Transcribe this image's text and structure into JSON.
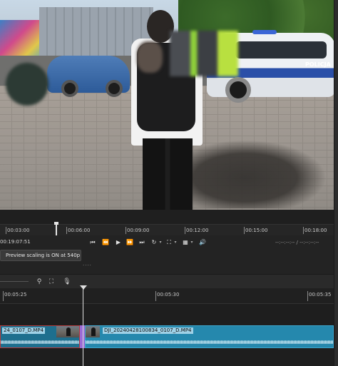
{
  "preview": {
    "scene_text": "POLICJA"
  },
  "ruler": {
    "ticks": [
      "00:03:00",
      "00:06:00",
      "00:09:00",
      "00:12:00",
      "00:15:00",
      "00:18:00"
    ]
  },
  "transport": {
    "timecode": "00:19:07:51",
    "buttons": [
      "skip-to-start",
      "rewind",
      "play",
      "fast-forward",
      "skip-to-end"
    ],
    "in_point": "--:--:--:--",
    "separator": "/",
    "out_point": "--:--:--:--"
  },
  "message": {
    "text": "Preview scaling is ON at 540p",
    "dots": "...."
  },
  "timeline": {
    "ruler_ticks": [
      "00:05:25",
      "00:05:30",
      "00:05:35"
    ],
    "clips": [
      {
        "name": "24_0107_D.MP4",
        "selected": true
      },
      {
        "name": "DJI_20240428100834_0107_D.MP4",
        "selected": false
      }
    ]
  },
  "colors": {
    "background": "#232323",
    "clip": "#2588ad",
    "clip_selected_border": "#b23a3a",
    "transition": "#9b6ad6"
  }
}
